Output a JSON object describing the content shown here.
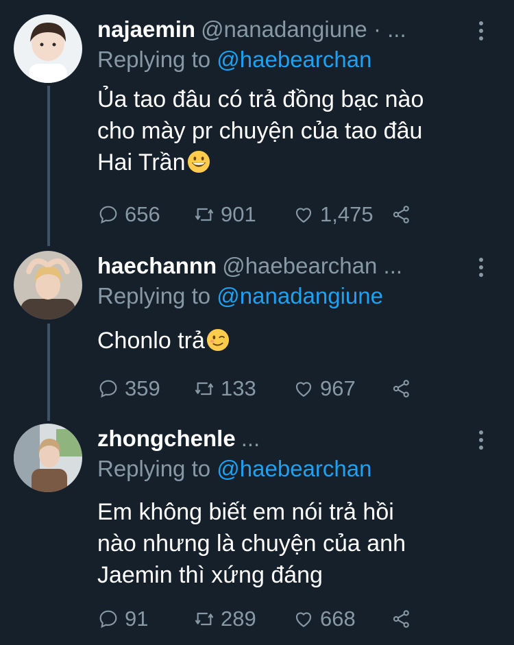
{
  "tweets": [
    {
      "name": "najaemin",
      "handle": "@nanadangiune · ...",
      "replying_prefix": "Replying to",
      "replying_to": "@haebearchan",
      "text_lines": [
        "Ủa tao đâu có trả đồng bạc nào",
        "cho mày pr chuyện của tao đâu",
        "Hai Trần"
      ],
      "emoji": "grinning-face-emoji",
      "replies": "656",
      "retweets": "901",
      "likes": "1,475"
    },
    {
      "name": "haechannn",
      "handle": "@haebearchan ...",
      "replying_prefix": "Replying to",
      "replying_to": "@nanadangiune",
      "text_lines": [
        "Chonlo trả"
      ],
      "emoji": "winking-face-emoji",
      "replies": "359",
      "retweets": "133",
      "likes": "967"
    },
    {
      "name": "zhongchenle",
      "handle": "...",
      "replying_prefix": "Replying to",
      "replying_to": "@haebearchan",
      "text_lines": [
        "Em không biết em nói trả hồi",
        "nào nhưng là chuyện của anh",
        "Jaemin thì xứng đáng"
      ],
      "emoji": "",
      "replies": "91",
      "retweets": "289",
      "likes": "668"
    }
  ],
  "colors": {
    "background": "#15202b",
    "text": "#ffffff",
    "secondary": "#8899a6",
    "link": "#1da1f2",
    "thread_line": "#3d5466"
  },
  "icons": [
    "reply-icon",
    "retweet-icon",
    "like-icon",
    "share-icon",
    "more-options-icon"
  ]
}
